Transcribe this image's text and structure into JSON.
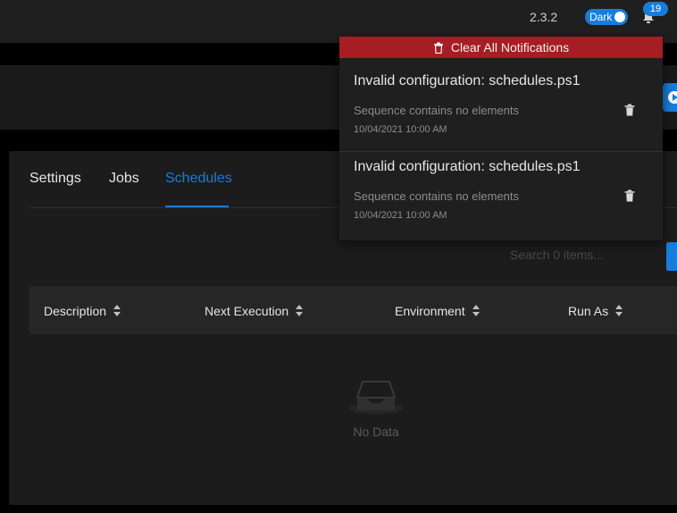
{
  "header": {
    "version": "2.3.2",
    "theme_label": "Dark",
    "notification_count": "19"
  },
  "notifications": {
    "clear_all_label": "Clear All Notifications",
    "items": [
      {
        "title": "Invalid configuration: schedules.ps1",
        "description": "Sequence contains no elements",
        "time": "10/04/2021 10:00 AM"
      },
      {
        "title": "Invalid configuration: schedules.ps1",
        "description": "Sequence contains no elements",
        "time": "10/04/2021 10:00 AM"
      }
    ]
  },
  "tabs": [
    {
      "label": "Settings",
      "active": false
    },
    {
      "label": "Jobs",
      "active": false
    },
    {
      "label": "Schedules",
      "active": true
    }
  ],
  "search": {
    "placeholder": "Search 0 items..."
  },
  "table": {
    "columns": [
      "Description",
      "Next Execution",
      "Environment",
      "Run As"
    ],
    "rows": [],
    "empty_text": "No Data"
  },
  "colors": {
    "accent": "#177ddc",
    "danger": "#a61d24"
  }
}
